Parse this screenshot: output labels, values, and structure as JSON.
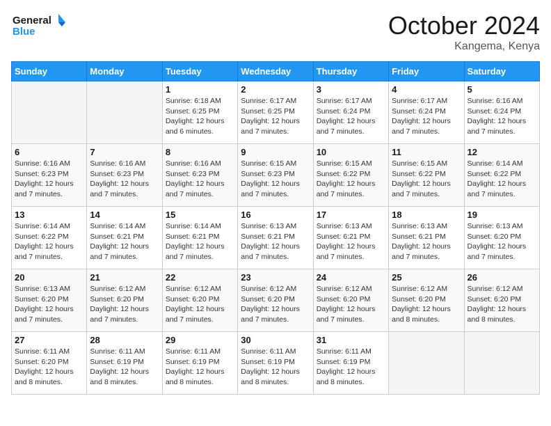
{
  "header": {
    "logo_line1": "General",
    "logo_line2": "Blue",
    "month_title": "October 2024",
    "location": "Kangema, Kenya"
  },
  "days_of_week": [
    "Sunday",
    "Monday",
    "Tuesday",
    "Wednesday",
    "Thursday",
    "Friday",
    "Saturday"
  ],
  "weeks": [
    [
      {
        "day": "",
        "info": ""
      },
      {
        "day": "",
        "info": ""
      },
      {
        "day": "1",
        "info": "Sunrise: 6:18 AM\nSunset: 6:25 PM\nDaylight: 12 hours and 6 minutes."
      },
      {
        "day": "2",
        "info": "Sunrise: 6:17 AM\nSunset: 6:25 PM\nDaylight: 12 hours and 7 minutes."
      },
      {
        "day": "3",
        "info": "Sunrise: 6:17 AM\nSunset: 6:24 PM\nDaylight: 12 hours and 7 minutes."
      },
      {
        "day": "4",
        "info": "Sunrise: 6:17 AM\nSunset: 6:24 PM\nDaylight: 12 hours and 7 minutes."
      },
      {
        "day": "5",
        "info": "Sunrise: 6:16 AM\nSunset: 6:24 PM\nDaylight: 12 hours and 7 minutes."
      }
    ],
    [
      {
        "day": "6",
        "info": "Sunrise: 6:16 AM\nSunset: 6:23 PM\nDaylight: 12 hours and 7 minutes."
      },
      {
        "day": "7",
        "info": "Sunrise: 6:16 AM\nSunset: 6:23 PM\nDaylight: 12 hours and 7 minutes."
      },
      {
        "day": "8",
        "info": "Sunrise: 6:16 AM\nSunset: 6:23 PM\nDaylight: 12 hours and 7 minutes."
      },
      {
        "day": "9",
        "info": "Sunrise: 6:15 AM\nSunset: 6:23 PM\nDaylight: 12 hours and 7 minutes."
      },
      {
        "day": "10",
        "info": "Sunrise: 6:15 AM\nSunset: 6:22 PM\nDaylight: 12 hours and 7 minutes."
      },
      {
        "day": "11",
        "info": "Sunrise: 6:15 AM\nSunset: 6:22 PM\nDaylight: 12 hours and 7 minutes."
      },
      {
        "day": "12",
        "info": "Sunrise: 6:14 AM\nSunset: 6:22 PM\nDaylight: 12 hours and 7 minutes."
      }
    ],
    [
      {
        "day": "13",
        "info": "Sunrise: 6:14 AM\nSunset: 6:22 PM\nDaylight: 12 hours and 7 minutes."
      },
      {
        "day": "14",
        "info": "Sunrise: 6:14 AM\nSunset: 6:21 PM\nDaylight: 12 hours and 7 minutes."
      },
      {
        "day": "15",
        "info": "Sunrise: 6:14 AM\nSunset: 6:21 PM\nDaylight: 12 hours and 7 minutes."
      },
      {
        "day": "16",
        "info": "Sunrise: 6:13 AM\nSunset: 6:21 PM\nDaylight: 12 hours and 7 minutes."
      },
      {
        "day": "17",
        "info": "Sunrise: 6:13 AM\nSunset: 6:21 PM\nDaylight: 12 hours and 7 minutes."
      },
      {
        "day": "18",
        "info": "Sunrise: 6:13 AM\nSunset: 6:21 PM\nDaylight: 12 hours and 7 minutes."
      },
      {
        "day": "19",
        "info": "Sunrise: 6:13 AM\nSunset: 6:20 PM\nDaylight: 12 hours and 7 minutes."
      }
    ],
    [
      {
        "day": "20",
        "info": "Sunrise: 6:13 AM\nSunset: 6:20 PM\nDaylight: 12 hours and 7 minutes."
      },
      {
        "day": "21",
        "info": "Sunrise: 6:12 AM\nSunset: 6:20 PM\nDaylight: 12 hours and 7 minutes."
      },
      {
        "day": "22",
        "info": "Sunrise: 6:12 AM\nSunset: 6:20 PM\nDaylight: 12 hours and 7 minutes."
      },
      {
        "day": "23",
        "info": "Sunrise: 6:12 AM\nSunset: 6:20 PM\nDaylight: 12 hours and 7 minutes."
      },
      {
        "day": "24",
        "info": "Sunrise: 6:12 AM\nSunset: 6:20 PM\nDaylight: 12 hours and 7 minutes."
      },
      {
        "day": "25",
        "info": "Sunrise: 6:12 AM\nSunset: 6:20 PM\nDaylight: 12 hours and 8 minutes."
      },
      {
        "day": "26",
        "info": "Sunrise: 6:12 AM\nSunset: 6:20 PM\nDaylight: 12 hours and 8 minutes."
      }
    ],
    [
      {
        "day": "27",
        "info": "Sunrise: 6:11 AM\nSunset: 6:20 PM\nDaylight: 12 hours and 8 minutes."
      },
      {
        "day": "28",
        "info": "Sunrise: 6:11 AM\nSunset: 6:19 PM\nDaylight: 12 hours and 8 minutes."
      },
      {
        "day": "29",
        "info": "Sunrise: 6:11 AM\nSunset: 6:19 PM\nDaylight: 12 hours and 8 minutes."
      },
      {
        "day": "30",
        "info": "Sunrise: 6:11 AM\nSunset: 6:19 PM\nDaylight: 12 hours and 8 minutes."
      },
      {
        "day": "31",
        "info": "Sunrise: 6:11 AM\nSunset: 6:19 PM\nDaylight: 12 hours and 8 minutes."
      },
      {
        "day": "",
        "info": ""
      },
      {
        "day": "",
        "info": ""
      }
    ]
  ]
}
